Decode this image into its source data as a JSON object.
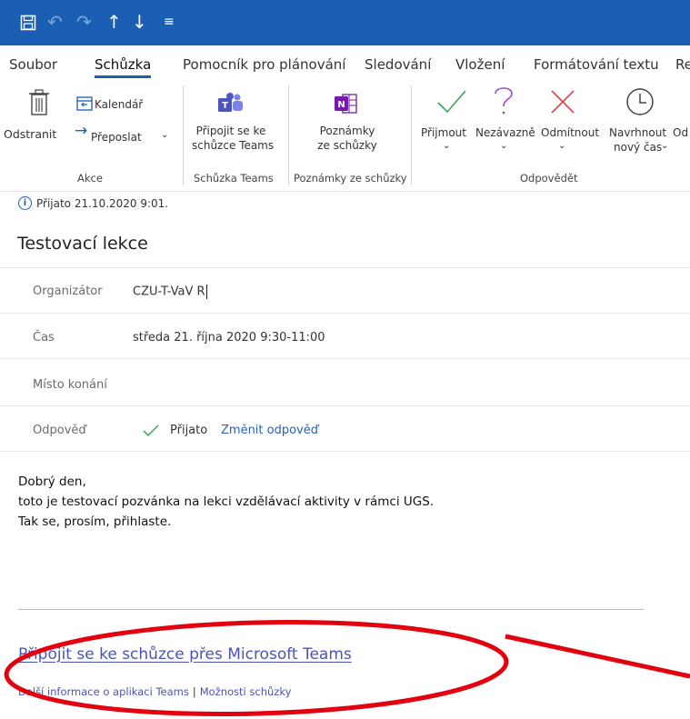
{
  "quick_access": {
    "save_icon": "save-icon",
    "undo_icon": "undo-icon",
    "redo_icon": "redo-icon",
    "up_icon": "arrow-up-icon",
    "down_icon": "arrow-down-icon",
    "customize_icon": "customize-toolbar-icon"
  },
  "tabs": [
    {
      "label": "Soubor"
    },
    {
      "label": "Schůzka"
    },
    {
      "label": "Pomocník pro plánování"
    },
    {
      "label": "Sledování"
    },
    {
      "label": "Vložení"
    },
    {
      "label": "Formátování textu"
    },
    {
      "label": "Re"
    }
  ],
  "ribbon": {
    "akce": {
      "delete_label": "Odstranit",
      "calendar_label": "Kalendář",
      "forward_label": "Přeposlat",
      "group_label": "Akce"
    },
    "teams": {
      "join_line1": "Připojit se ke",
      "join_line2": "schůzce Teams",
      "group_label": "Schůzka Teams"
    },
    "notes": {
      "line1": "Poznámky",
      "line2": "ze schůzky",
      "group_label": "Poznámky ze schůzky"
    },
    "respond": {
      "accept_label": "Přijmout",
      "tentative_label": "Nezávazně",
      "decline_label": "Odmítnout",
      "propose_line1": "Navrhnout",
      "propose_line2": "nový čas",
      "cut_label": "Od",
      "group_label": "Odpovědět"
    }
  },
  "meeting": {
    "info_text": "Přijato 21.10.2020 9:01.",
    "subject": "Testovací lekce",
    "organizer_label": "Organizátor",
    "organizer_value": "CZU-T-VaV R",
    "time_label": "Čas",
    "time_value": "středa 21. října 2020 9:30-11:00",
    "location_label": "Místo konání",
    "location_value": "",
    "response_label": "Odpověď",
    "response_value": "Přijato",
    "change_response_link": "Změnit odpověď"
  },
  "body": {
    "line1": "Dobrý den,",
    "line2": "toto je testovací pozvánka na lekci vzdělávací aktivity v rámci UGS.",
    "line3": "Tak se, prosím, přihlaste."
  },
  "teams_block": {
    "join_link": "Připojit se ke schůzce přes Microsoft Teams",
    "learn_more": "Další informace o aplikaci Teams",
    "separator": "|",
    "meeting_options": "Možnosti schůzky"
  },
  "colors": {
    "title_bar": "#1a5fb4",
    "link": "#2b5fb8",
    "teams_link": "#4a53b8",
    "accept_green": "#3aa655",
    "decline_red": "#e04343",
    "tentative_purple": "#a24cc7",
    "annotation_red": "#e3000f"
  }
}
